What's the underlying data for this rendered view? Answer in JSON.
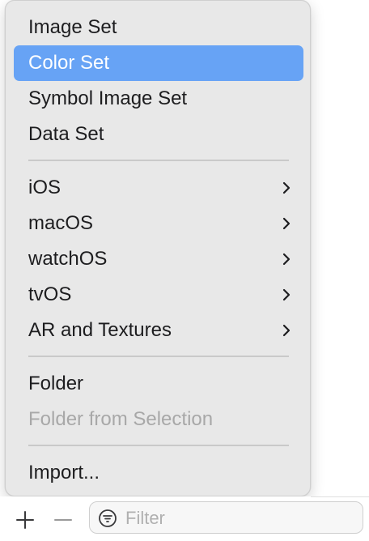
{
  "menu": {
    "items": [
      {
        "label": "Image Set"
      },
      {
        "label": "Color Set",
        "selected": true
      },
      {
        "label": "Symbol Image Set"
      },
      {
        "label": "Data Set"
      },
      {
        "label": "iOS",
        "submenu": true
      },
      {
        "label": "macOS",
        "submenu": true
      },
      {
        "label": "watchOS",
        "submenu": true
      },
      {
        "label": "tvOS",
        "submenu": true
      },
      {
        "label": "AR and Textures",
        "submenu": true
      },
      {
        "label": "Folder"
      },
      {
        "label": "Folder from Selection",
        "disabled": true
      },
      {
        "label": "Import..."
      }
    ]
  },
  "toolbar": {
    "add_icon": "plus-icon",
    "remove_icon": "minus-icon",
    "filter": {
      "icon": "filter-icon",
      "placeholder": "Filter",
      "value": ""
    }
  },
  "colors": {
    "selection": "#67a3f5",
    "menu_background": "#e8e8e8",
    "disabled_text": "#a8a8a8"
  }
}
